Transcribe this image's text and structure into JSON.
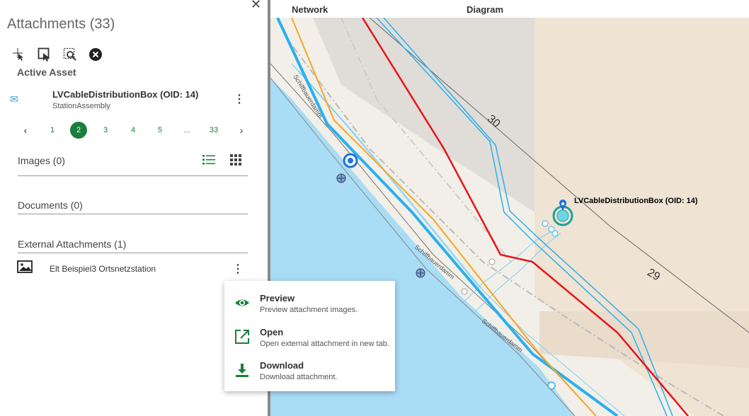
{
  "panel": {
    "title": "Attachments (33)",
    "active_asset_heading": "Active Asset",
    "asset": {
      "name": "LVCableDistributionBox (OID: 14)",
      "type": "StationAssembly"
    },
    "pager": {
      "prev": "‹",
      "next": "›",
      "pages": [
        "1",
        "2",
        "3",
        "4",
        "5",
        "...",
        "33"
      ],
      "active": "2"
    },
    "images": {
      "title": "Images (0)"
    },
    "documents": {
      "title": "Documents (0)"
    },
    "external": {
      "title": "External Attachments (1)",
      "items": [
        {
          "name": "Elt Beispiel3 Ortsnetzstation"
        }
      ]
    }
  },
  "map": {
    "tabs": [
      "Network",
      "Diagram"
    ],
    "feature_label": "LVCableDistributionBox (OID: 14)",
    "parcels": [
      "30",
      "29"
    ]
  },
  "context_menu": {
    "items": [
      {
        "title": "Preview",
        "description": "Preview attachment images.",
        "icon": "eye-icon"
      },
      {
        "title": "Open",
        "description": "Open external attachment in new tab.",
        "icon": "open-external-icon"
      },
      {
        "title": "Download",
        "description": "Download attachment.",
        "icon": "download-icon"
      }
    ]
  },
  "colors": {
    "accent": "#1a7f3c",
    "water": "#a9dcf5",
    "cable_blue": "#2ab0ee",
    "cable_red": "#e8141b",
    "cable_orange": "#f6a623"
  }
}
